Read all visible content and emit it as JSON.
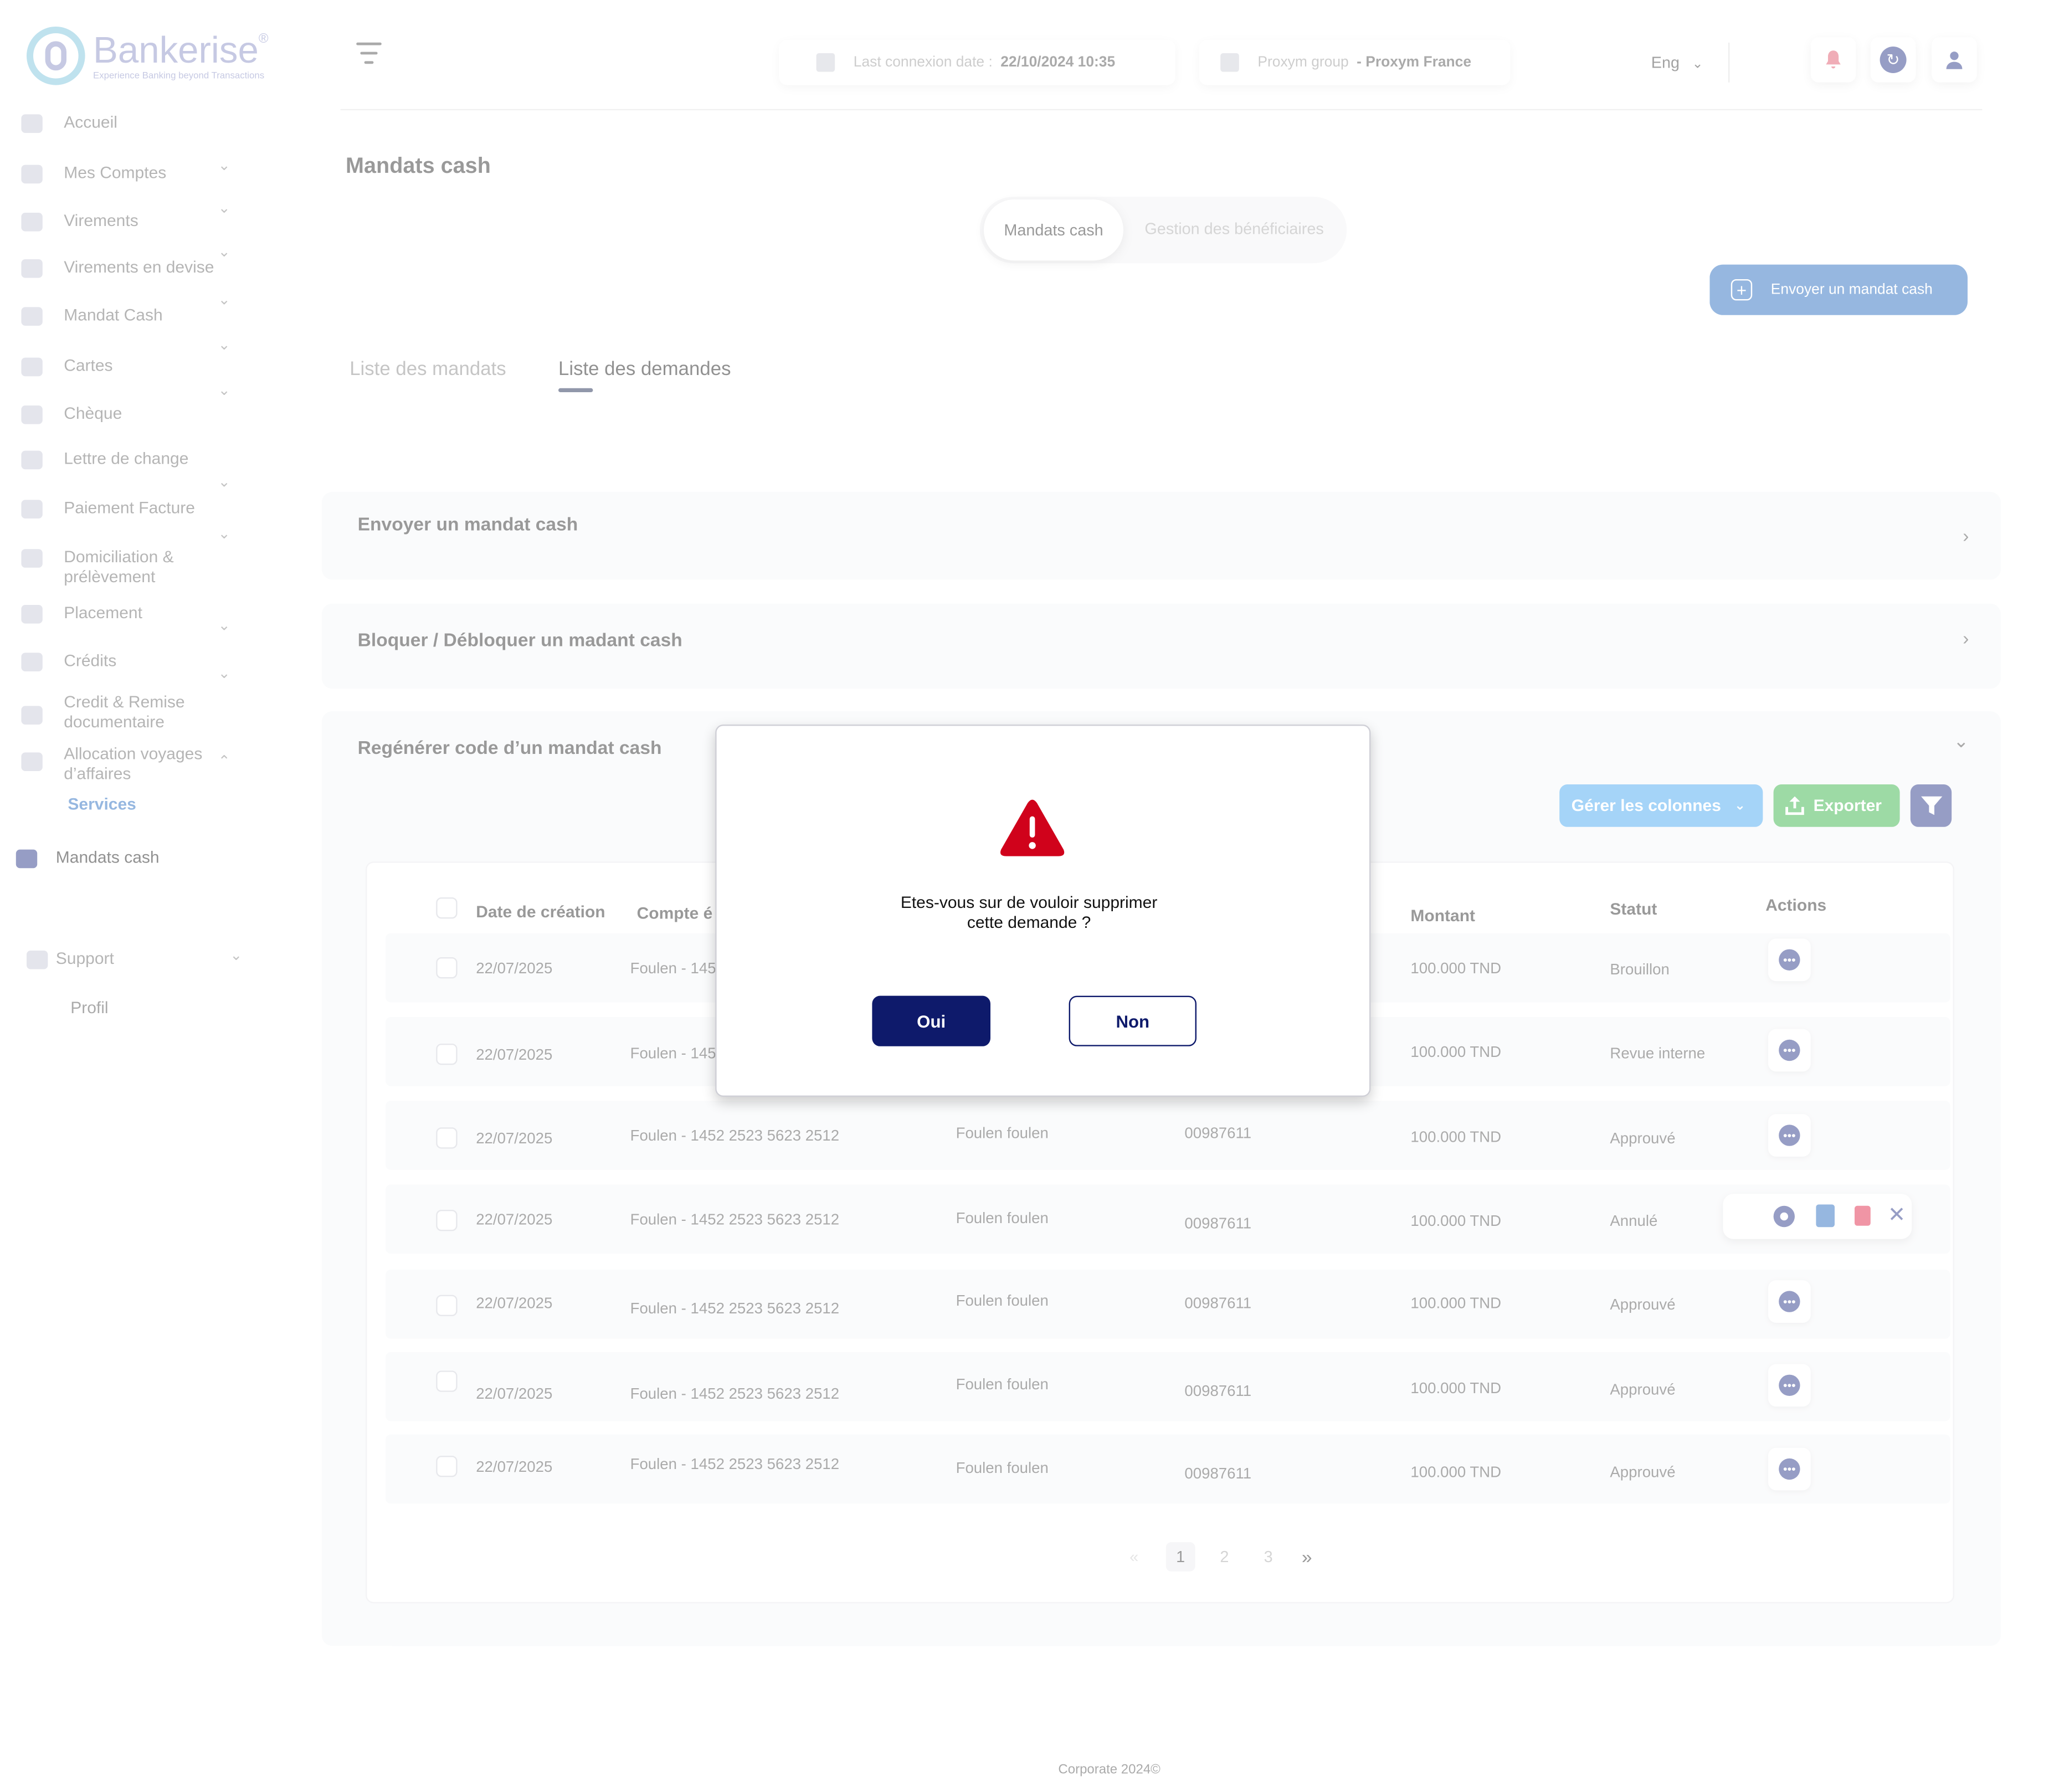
{
  "brand": {
    "name": "Bankerise",
    "reg": "®",
    "tagline": "Experience Banking beyond Transactions"
  },
  "header": {
    "last_conn_label": "Last connexion date :",
    "last_conn_value": "22/10/2024 10:35",
    "group_label": "Proxym group",
    "group_value": "- Proxym France",
    "lang": "Eng"
  },
  "sidebar": {
    "items": [
      {
        "label": "Accueil"
      },
      {
        "label": "Mes Comptes"
      },
      {
        "label": "Virements"
      },
      {
        "label": "Virements en devise"
      },
      {
        "label": "Mandat Cash"
      },
      {
        "label": "Cartes"
      },
      {
        "label": "Chèque"
      },
      {
        "label": "Lettre de change"
      },
      {
        "label": "Paiement Facture"
      },
      {
        "label": "Domiciliation &\nprélèvement"
      },
      {
        "label": "Placement"
      },
      {
        "label": "Crédits"
      },
      {
        "label": "Credit & Remise\ndocumentaire"
      },
      {
        "label": "Allocation  voyages\nd’affaires"
      }
    ],
    "services": "Services",
    "active": "Mandats cash",
    "support": "Support",
    "profil": "Profil"
  },
  "page": {
    "title": "Mandats cash",
    "seg_active": "Mandats cash",
    "seg_inactive": "Gestion des bénéficiaires",
    "send_button": "Envoyer un mandat cash",
    "tab_mandats": "Liste des mandats",
    "tab_demandes": "Liste des demandes"
  },
  "accordions": {
    "send": "Envoyer un mandat cash",
    "block": "Bloquer / Débloquer un madant cash",
    "regen": "Regénérer code d’un mandat cash"
  },
  "toolbar": {
    "columns": "Gérer les colonnes",
    "export": "Exporter"
  },
  "table": {
    "headers": {
      "date": "Date de création",
      "compte": "Compte é",
      "montant": "Montant",
      "statut": "Statut",
      "actions": "Actions"
    },
    "rows": [
      {
        "date": "22/07/2025",
        "compte": "Foulen - 145",
        "benef": "",
        "ref": "",
        "montant": "100.000 TND",
        "statut": "Brouillon"
      },
      {
        "date": "22/07/2025",
        "compte": "Foulen - 145",
        "benef": "",
        "ref": "",
        "montant": "100.000 TND",
        "statut": "Revue interne"
      },
      {
        "date": "22/07/2025",
        "compte": "Foulen - 1452 2523 5623 2512",
        "benef": "Foulen foulen",
        "ref": "00987611",
        "montant": "100.000 TND",
        "statut": "Approuvé"
      },
      {
        "date": "22/07/2025",
        "compte": "Foulen - 1452 2523 5623 2512",
        "benef": "Foulen foulen",
        "ref": "00987611",
        "montant": "100.000 TND",
        "statut": "Annulé"
      },
      {
        "date": "22/07/2025",
        "compte": "Foulen - 1452 2523 5623 2512",
        "benef": "Foulen foulen",
        "ref": "00987611",
        "montant": "100.000 TND",
        "statut": "Approuvé"
      },
      {
        "date": "22/07/2025",
        "compte": "Foulen - 1452 2523 5623 2512",
        "benef": "Foulen foulen",
        "ref": "00987611",
        "montant": "100.000 TND",
        "statut": "Approuvé"
      },
      {
        "date": "22/07/2025",
        "compte": "Foulen - 1452 2523 5623 2512",
        "benef": "Foulen foulen",
        "ref": "00987611",
        "montant": "100.000 TND",
        "statut": "Approuvé"
      }
    ]
  },
  "pagination": {
    "prev": "«",
    "pages": [
      "1",
      "2",
      "3"
    ],
    "next": "»"
  },
  "footer": "Corporate 2024©",
  "modal": {
    "message_line1": "Etes-vous sur de vouloir  supprimer",
    "message_line2": "cette demande  ?",
    "yes": "Oui",
    "no": "Non"
  },
  "colors": {
    "primary": "#0e1a6b",
    "accent": "#2d6fc0",
    "danger": "#d0021b",
    "export": "#3bb54a",
    "columns": "#4aa8f0"
  }
}
